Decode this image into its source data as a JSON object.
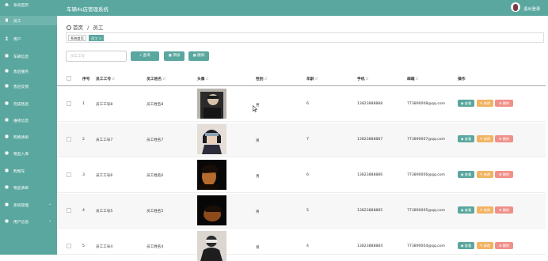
{
  "header": {
    "system_title": "车辆4s店管理系统",
    "logout_label": "退出登录"
  },
  "sidebar": {
    "items": [
      {
        "label": "系统首页",
        "icon": "home-icon"
      },
      {
        "label": "员工",
        "icon": "document-icon",
        "active": true
      },
      {
        "label": "用户",
        "icon": "user-icon"
      },
      {
        "label": "车辆信息",
        "icon": "car-icon"
      },
      {
        "label": "售后服务",
        "icon": "service-icon"
      },
      {
        "label": "售后反馈",
        "icon": "feedback-icon"
      },
      {
        "label": "完成售后",
        "icon": "check-icon"
      },
      {
        "label": "维修信息",
        "icon": "wrench-icon"
      },
      {
        "label": "购物清单",
        "icon": "list-icon"
      },
      {
        "label": "物品入库",
        "icon": "box-icon"
      },
      {
        "label": "购物车",
        "icon": "cart-icon"
      },
      {
        "label": "物品清单",
        "icon": "clipboard-icon"
      },
      {
        "label": "系统管理",
        "icon": "settings-icon",
        "expandable": true
      },
      {
        "label": "用户信息",
        "icon": "id-card-icon",
        "expandable": true
      }
    ]
  },
  "breadcrumb": {
    "home": "首页",
    "separator": "/",
    "current": "员工"
  },
  "tags": {
    "home": "系统首页",
    "current": "员工",
    "close": "×"
  },
  "search": {
    "placeholder": "员工工号",
    "value": "",
    "query_label": "查询",
    "add_label": "添加",
    "delete_label": "删除"
  },
  "table": {
    "columns": [
      "序号",
      "员工工号",
      "员工姓名",
      "头像",
      "性别",
      "年龄",
      "手机",
      "邮箱",
      "操作"
    ],
    "rows": [
      {
        "index": "1",
        "emp_id": "员工工号8",
        "name": "员工姓名8",
        "gender": "男",
        "age": "6",
        "phone": "13823888888",
        "email": "773890008@qq.com"
      },
      {
        "index": "2",
        "emp_id": "员工工号7",
        "name": "员工姓名7",
        "gender": "男",
        "age": "7",
        "phone": "13823888887",
        "email": "773890007@qq.com"
      },
      {
        "index": "3",
        "emp_id": "员工工号6",
        "name": "员工姓名6",
        "gender": "男",
        "age": "6",
        "phone": "13823888886",
        "email": "773890006@qq.com"
      },
      {
        "index": "4",
        "emp_id": "员工工号5",
        "name": "员工姓名5",
        "gender": "男",
        "age": "5",
        "phone": "13823888885",
        "email": "773890005@qq.com"
      },
      {
        "index": "5",
        "emp_id": "员工工号4",
        "name": "员工姓名4",
        "gender": "男",
        "age": "4",
        "phone": "13823888884",
        "email": "773890004@qq.com"
      }
    ],
    "actions": {
      "view": "查看",
      "edit": "修改",
      "delete": "删除"
    }
  },
  "colors": {
    "primary": "#5aa79f",
    "edit": "#f1b463",
    "delete": "#f0908a"
  }
}
